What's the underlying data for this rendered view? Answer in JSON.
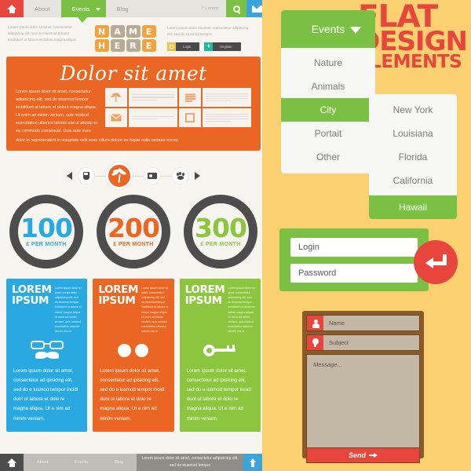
{
  "left_template": {
    "topnav": {
      "home_icon": "home-icon",
      "items": [
        {
          "label": "About",
          "active": false
        },
        {
          "label": "Events",
          "active": true
        },
        {
          "label": "Blog",
          "active": false
        }
      ],
      "lorem": "7 Lorem",
      "search_icon": "search-icon",
      "mail_icon": "envelope-icon"
    },
    "header": {
      "left_text": "Lorem ipsum dolor sit amet, consectetur adipiscing elit, sed do eiusmod tempor incididunt ut labore et dolore magna aliqua.",
      "logo_line1": [
        "N",
        "A",
        "M",
        "E"
      ],
      "logo_line2": [
        "H",
        "E",
        "R",
        "E"
      ],
      "right_text": "Lorem ipsum dolor sit amet, consectetur adipiscing elit, sed do eiusmod tempor",
      "login_label": "Login",
      "register_label": "Register",
      "lock_icon": "lock-icon",
      "plus_icon": "plus-icon"
    },
    "hero": {
      "title": "Dolor sit amet",
      "paragraph": "Lorem ipsum dolor sit amet, consectetur adipisicing elit, sed do eiusmod tempor incididunt ut labore et dolore magna aliqua. Ut enim ad minim veniam, quis nostrud exercitation ullamco laboris nisi ut aliquip ex ea commodo consequat. Duis aute irure",
      "footer_line": "dolor in reprehenderit in voluptate velit esse cillum dolore eu fugiat nulla pariatur excep.",
      "grid_icons": [
        "palm-icon",
        "stack-icon",
        "envelope-icon",
        "frame-icon"
      ]
    },
    "carousel": {
      "prev_icon": "arrow-left-icon",
      "next_icon": "arrow-right-icon",
      "items": [
        {
          "icon": "coffee-cup-icon",
          "active": false
        },
        {
          "icon": "palm-tree-icon",
          "active": true
        },
        {
          "icon": "camera-icon",
          "active": false
        },
        {
          "icon": "paw-print-icon",
          "active": false
        }
      ]
    },
    "pricing": [
      {
        "amount": "100",
        "period": "£ PER MONTH",
        "color": "#29a9e1"
      },
      {
        "amount": "200",
        "period": "£ PER MONTH",
        "color": "#ec6623"
      },
      {
        "amount": "300",
        "period": "£ PER MONTH",
        "color": "#8cc63e"
      }
    ],
    "cards": [
      {
        "title_line1": "LOREM",
        "title_line2": "IPSUM",
        "lorem": "Lorem ipsum dolor sit amet, consectetur adipisicing elit, sed do eiusmod tempor incididunt ut labore et dolore magna aliqua. Ut enim ad minim veniam, quis nostrud exercitation ullamco laboris nisi ut",
        "icon": "glasses-mustache-icon",
        "body": "Lorem ipsum dolor sit amet, consectetur ad ipisicing elit, sed do e iusmod tempor incidi dunt ut labore et dolo re magna aliqua. Ut e nim ad minim veniam.",
        "color": "#29a9e1"
      },
      {
        "title_line1": "LOREM",
        "title_line2": "IPSUM",
        "lorem": "Lorem ipsum dolor sit amet, consectetur adipisicing elit, sed do eiusmod tempor incididunt ut labore et dolore magna aliqua. Ut enim ad minim veniam, quis nostrud exercitation ullamco laboris nisi ut",
        "icon": "two-dots-icon",
        "body": "Lorem ipsum dolor sit amet, consectetur ad ipisicing elit, sed do e iusmod tempor incidi dunt ut labore et dolo re magna aliqua. Ut e nim ad minim veniam.",
        "color": "#ec6623"
      },
      {
        "title_line1": "LOREM",
        "title_line2": "IPSUM",
        "lorem": "Lorem ipsum dolor sit amet, consectetur adipisicing elit, sed do eiusmod tempor incididunt ut labore et dolore magna aliqua. Ut enim ad minim veniam, quis nostrud exercitation ullamco laboris nisi ut",
        "icon": "key-icon",
        "body": "Lorem ipsum dolor sit amet, consectetur ad ipisicing elit, sed do e iusmod tempor incidi dunt ut labore et dolo re magna aliqua. Ut e nim ad minim veniam.",
        "color": "#8cc63e"
      }
    ],
    "footer": {
      "home_icon": "home-icon",
      "items": [
        "About",
        "Events",
        "Blog"
      ],
      "note": "Lorem ipsum dolor sit amet, consectetur adipisicing elit, sed do eiusmod tempor",
      "up_icon": "arrow-up-icon"
    }
  },
  "right_panel": {
    "dropdown": {
      "header_label": "Events",
      "caret_icon": "chevron-down-icon",
      "items": [
        {
          "label": "Nature",
          "selected": false
        },
        {
          "label": "Animals",
          "selected": false
        },
        {
          "label": "City",
          "selected": true
        },
        {
          "label": "Portait",
          "selected": false
        },
        {
          "label": "Other",
          "selected": false
        }
      ]
    },
    "submenu": {
      "items": [
        {
          "label": "New York",
          "selected": false
        },
        {
          "label": "Louisiana",
          "selected": false
        },
        {
          "label": "Florida",
          "selected": false
        },
        {
          "label": "California",
          "selected": false
        },
        {
          "label": "Hawaii",
          "selected": true
        }
      ]
    },
    "title": {
      "line1": "FLAT",
      "line2": "DESIGN",
      "line3": "ELEMENTS",
      "color": "#e8453c"
    },
    "login_form": {
      "login_placeholder": "Login",
      "password_placeholder": "Password",
      "submit_icon": "enter-arrow-icon",
      "background": "#7ac143",
      "button_color": "#e8453c"
    },
    "contact_form": {
      "name_placeholder": "Name",
      "name_icon": "person-icon",
      "subject_placeholder": "Subject",
      "subject_icon": "bulb-icon",
      "message_placeholder": "Message...",
      "send_label": "Send",
      "send_arrow_icon": "arrow-right-icon"
    }
  }
}
